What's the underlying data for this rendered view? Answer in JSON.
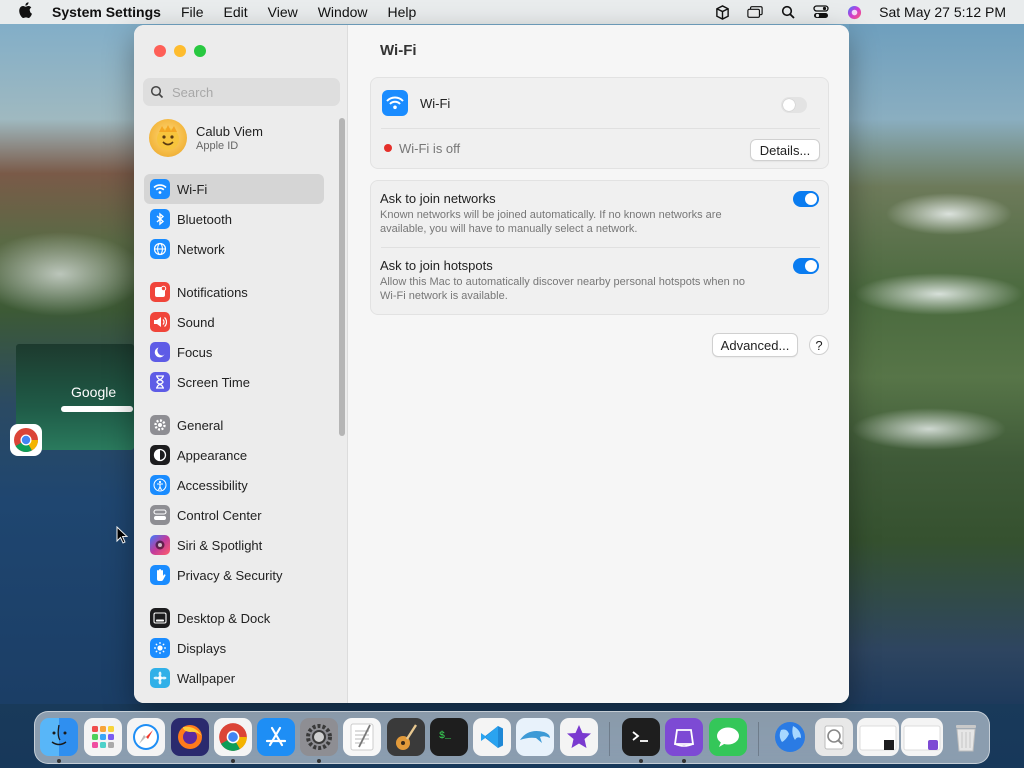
{
  "menubar": {
    "app_name": "System Settings",
    "menus": [
      "File",
      "Edit",
      "View",
      "Window",
      "Help"
    ],
    "clock": "Sat May 27  5:12 PM"
  },
  "sidebar": {
    "search_placeholder": "Search",
    "user": {
      "name": "Calub Viem",
      "subtitle": "Apple ID"
    },
    "items": [
      {
        "label": "Wi-Fi",
        "icon": "wifi-icon",
        "color": "#1a8cff"
      },
      {
        "label": "Bluetooth",
        "icon": "bluetooth-icon",
        "color": "#1a8cff"
      },
      {
        "label": "Network",
        "icon": "globe-icon",
        "color": "#1a8cff"
      },
      {
        "label": "Notifications",
        "icon": "bell-icon",
        "color": "#f0453a"
      },
      {
        "label": "Sound",
        "icon": "speaker-icon",
        "color": "#f0453a"
      },
      {
        "label": "Focus",
        "icon": "moon-icon",
        "color": "#5e5ce6"
      },
      {
        "label": "Screen Time",
        "icon": "hourglass-icon",
        "color": "#5e5ce6"
      },
      {
        "label": "General",
        "icon": "gear-icon",
        "color": "#8e8e93"
      },
      {
        "label": "Appearance",
        "icon": "appearance-icon",
        "color": "#1c1c1e"
      },
      {
        "label": "Accessibility",
        "icon": "accessibility-icon",
        "color": "#1a8cff"
      },
      {
        "label": "Control Center",
        "icon": "control-center-icon",
        "color": "#8e8e93"
      },
      {
        "label": "Siri & Spotlight",
        "icon": "siri-icon",
        "color": "#c23b9b"
      },
      {
        "label": "Privacy & Security",
        "icon": "hand-icon",
        "color": "#1a8cff"
      },
      {
        "label": "Desktop & Dock",
        "icon": "dock-icon",
        "color": "#1c1c1e"
      },
      {
        "label": "Displays",
        "icon": "sun-icon",
        "color": "#1a8cff"
      },
      {
        "label": "Wallpaper",
        "icon": "wallpaper-icon",
        "color": "#30b0e8"
      }
    ]
  },
  "content": {
    "title": "Wi-Fi",
    "wifi_label": "Wi-Fi",
    "wifi_enabled": false,
    "status_text": "Wi-Fi is off",
    "details_button": "Details...",
    "options": [
      {
        "title": "Ask to join networks",
        "description": "Known networks will be joined automatically. If no known networks are available, you will have to manually select a network.",
        "enabled": true
      },
      {
        "title": "Ask to join hotspots",
        "description": "Allow this Mac to automatically discover nearby personal hotspots when no Wi-Fi network is available.",
        "enabled": true
      }
    ],
    "advanced_button": "Advanced...",
    "help_button": "?"
  },
  "desktop": {
    "chrome_thumbnail_text": "Google"
  },
  "dock": {
    "apps": [
      {
        "name": "finder",
        "color": "#3da0f5",
        "running": true
      },
      {
        "name": "launchpad",
        "color": "#f4f4f4",
        "running": false
      },
      {
        "name": "safari",
        "color": "#f4f4f4",
        "running": false
      },
      {
        "name": "firefox",
        "color": "#2a2a6e",
        "running": false
      },
      {
        "name": "chrome",
        "color": "#f4f4f4",
        "running": true
      },
      {
        "name": "app-store",
        "color": "#1e8ef5",
        "running": false
      },
      {
        "name": "system-settings",
        "color": "#8e8e93",
        "running": true
      },
      {
        "name": "textedit",
        "color": "#f7f7f7",
        "running": false
      },
      {
        "name": "garageband",
        "color": "#3a3a3a",
        "running": false
      },
      {
        "name": "terminal-green",
        "color": "#1e1e1e",
        "running": false
      },
      {
        "name": "vscode",
        "color": "#f4f4f4",
        "running": false
      },
      {
        "name": "dolphin",
        "color": "#e8f2fb",
        "running": false
      },
      {
        "name": "imovie",
        "color": "#f4f4f4",
        "running": false
      },
      {
        "name": "terminal",
        "color": "#1e1e1e",
        "running": true
      },
      {
        "name": "podman",
        "color": "#7d4ad4",
        "running": true
      },
      {
        "name": "messages",
        "color": "#34c759",
        "running": false
      },
      {
        "name": "network-globe",
        "color": "#2a7be4",
        "running": false
      },
      {
        "name": "preview",
        "color": "#e8e8e8",
        "running": false
      },
      {
        "name": "window-thumb-1",
        "color": "#f4f4f4",
        "running": false
      },
      {
        "name": "window-thumb-2",
        "color": "#f4f4f4",
        "running": false
      },
      {
        "name": "trash",
        "color": "#e0e0e0",
        "running": false
      }
    ]
  }
}
